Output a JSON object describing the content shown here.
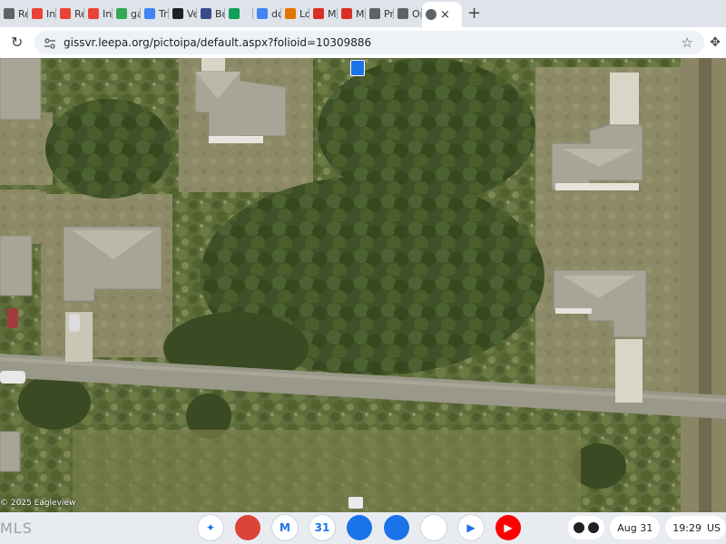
{
  "browser": {
    "tabs": [
      {
        "label": "Re",
        "icon": "generic-page-icon",
        "color": "#5f6368"
      },
      {
        "label": "Inb",
        "icon": "gmail-icon",
        "color": "#ea4335"
      },
      {
        "label": "Re",
        "icon": "gmail-icon",
        "color": "#ea4335"
      },
      {
        "label": "Inb",
        "icon": "gmail-icon",
        "color": "#ea4335"
      },
      {
        "label": "ga",
        "icon": "plus-green-icon",
        "color": "#34a853"
      },
      {
        "label": "Tra",
        "icon": "translate-icon",
        "color": "#4285f4"
      },
      {
        "label": "Ve",
        "icon": "at-sign-icon",
        "color": "#202124"
      },
      {
        "label": "Bo",
        "icon": "half-moon-icon",
        "color": "#3c4a8a"
      },
      {
        "label": "",
        "icon": "green-circle-icon",
        "color": "#0f9d58"
      },
      {
        "label": "do",
        "icon": "smiley-icon",
        "color": "#4285f4"
      },
      {
        "label": "Lo",
        "icon": "box-icon",
        "color": "#e37400"
      },
      {
        "label": "Ma",
        "icon": "red-c-icon",
        "color": "#d93025"
      },
      {
        "label": "Ma",
        "icon": "red-c-icon",
        "color": "#d93025"
      },
      {
        "label": "Pr",
        "icon": "globe-icon",
        "color": "#5f6368"
      },
      {
        "label": "On",
        "icon": "globe-icon",
        "color": "#5f6368"
      }
    ],
    "active_tab": {
      "label": "",
      "icon": "globe-icon",
      "close": "×"
    },
    "new_tab": "+",
    "url": "gissvr.leepa.org/pictoipa/default.aspx?folioid=10309886"
  },
  "map": {
    "copyright": "© 2025 Eagleview"
  },
  "taskbar": {
    "left_label": "MLS",
    "date": "Aug 31",
    "time": "19:29",
    "locale": "US",
    "apps": [
      {
        "name": "assistant-icon",
        "color": "#ffffff",
        "text": "✦"
      },
      {
        "name": "chrome-icon",
        "color": "#db4437",
        "text": ""
      },
      {
        "name": "gmail-app-icon",
        "color": "#ffffff",
        "text": "M"
      },
      {
        "name": "calendar-icon",
        "color": "#ffffff",
        "text": "31"
      },
      {
        "name": "files-icon",
        "color": "#1a73e8",
        "text": ""
      },
      {
        "name": "messages-icon",
        "color": "#1a73e8",
        "text": ""
      },
      {
        "name": "meet-icon",
        "color": "#ffffff",
        "text": ""
      },
      {
        "name": "play-store-icon",
        "color": "#ffffff",
        "text": "▶"
      },
      {
        "name": "youtube-icon",
        "color": "#ff0000",
        "text": "▶"
      }
    ]
  }
}
